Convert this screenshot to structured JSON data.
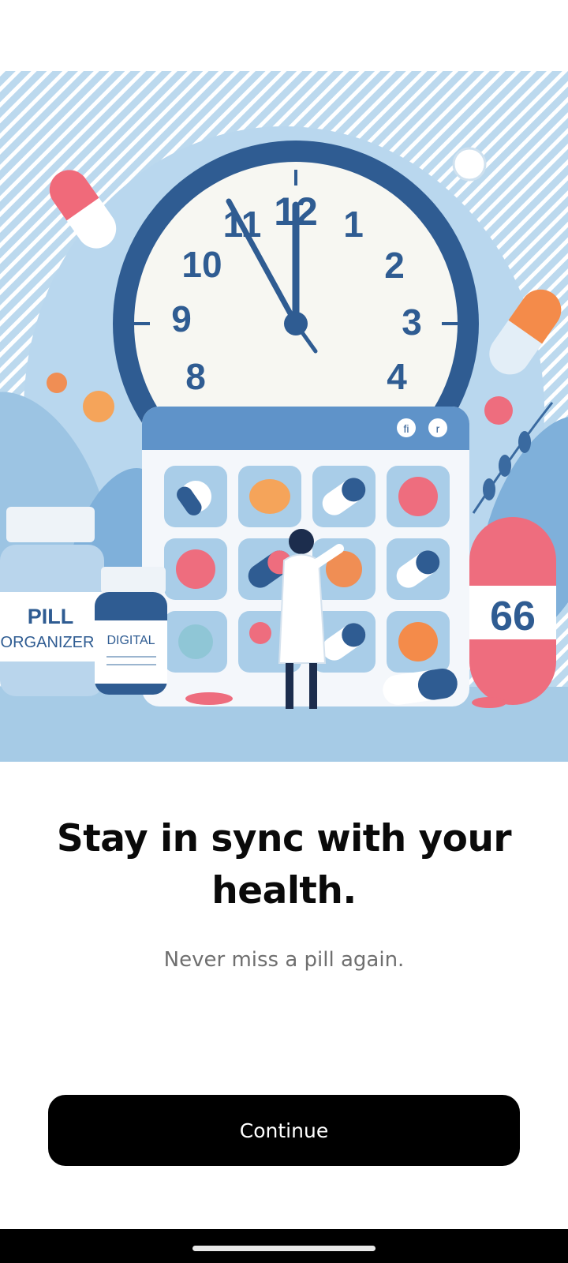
{
  "onboarding": {
    "headline": "Stay in sync with your health.",
    "subtitle": "Never miss a pill again.",
    "continue_label": "Continue"
  },
  "illustration": {
    "clock_numerals": [
      "12",
      "1",
      "2",
      "3",
      "4",
      "8",
      "9",
      "10",
      "11"
    ],
    "bottle_left_label": "PILL",
    "bottle_left_label2": "ORGANIZER",
    "bottle_small_label": "DIGITAL",
    "capsule_number": "66",
    "calendar_icon_a": "fi",
    "calendar_icon_b": "r"
  },
  "colors": {
    "background": "#ffffff",
    "button": "#000000",
    "button_text": "#ffffff",
    "headline": "#0a0a0a",
    "subtitle": "#6f6f6f",
    "illustration_blue": "#2f5c92",
    "illustration_sky": "#a9cde8"
  }
}
